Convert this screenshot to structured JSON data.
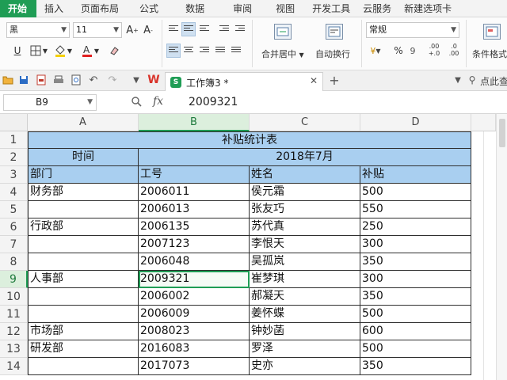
{
  "menu": {
    "tabs": [
      "开始",
      "插入",
      "页面布局",
      "公式",
      "数据",
      "审阅",
      "视图",
      "开发工具",
      "云服务",
      "新建选项卡"
    ]
  },
  "ribbon": {
    "font_name": "黑",
    "font_size": "11",
    "number_format": "常规",
    "merge_label": "合并居中",
    "wrap_label": "自动换行",
    "cond_format_label": "条件格式",
    "underline": "U",
    "grow_font": "A+",
    "shrink_font": "A-",
    "percent": "%",
    "thousands": "9",
    "inc_decimal": ".00",
    "dec_decimal": ".0"
  },
  "tabs": {
    "doc_title": "工作簿3 *",
    "search_text": "点此查"
  },
  "formula_bar": {
    "name_box": "B9",
    "fx_label": "fx",
    "value": "2009321"
  },
  "sheet": {
    "columns": [
      "A",
      "B",
      "C",
      "D"
    ],
    "rows": [
      "1",
      "2",
      "3",
      "4",
      "5",
      "6",
      "7",
      "8",
      "9",
      "10",
      "11",
      "12",
      "13",
      "14"
    ],
    "selected_cell": "B9",
    "title": "补贴统计表",
    "time_label": "时间",
    "month_label": "2018年7月",
    "headers": [
      "部门",
      "工号",
      "姓名",
      "补贴"
    ],
    "records": [
      {
        "dept": "财务部",
        "id": "2006011",
        "name": "侯元霜",
        "amount": "500"
      },
      {
        "dept": "",
        "id": "2006013",
        "name": "张友巧",
        "amount": "550"
      },
      {
        "dept": "行政部",
        "id": "2006135",
        "name": "苏代真",
        "amount": "250"
      },
      {
        "dept": "",
        "id": "2007123",
        "name": "李恨天",
        "amount": "300"
      },
      {
        "dept": "",
        "id": "2006048",
        "name": "吴孤岚",
        "amount": "350"
      },
      {
        "dept": "人事部",
        "id": "2009321",
        "name": "崔梦琪",
        "amount": "300"
      },
      {
        "dept": "",
        "id": "2006002",
        "name": "郝凝天",
        "amount": "350"
      },
      {
        "dept": "",
        "id": "2006009",
        "name": "姜怀蝶",
        "amount": "500"
      },
      {
        "dept": "市场部",
        "id": "2008023",
        "name": "钟妙菡",
        "amount": "600"
      },
      {
        "dept": "研发部",
        "id": "2016083",
        "name": "罗泽",
        "amount": "500"
      },
      {
        "dept": "",
        "id": "2017073",
        "name": "史亦",
        "amount": "350"
      }
    ]
  },
  "colors": {
    "accent": "#1f9d55",
    "header_fill": "#a9cff0"
  }
}
